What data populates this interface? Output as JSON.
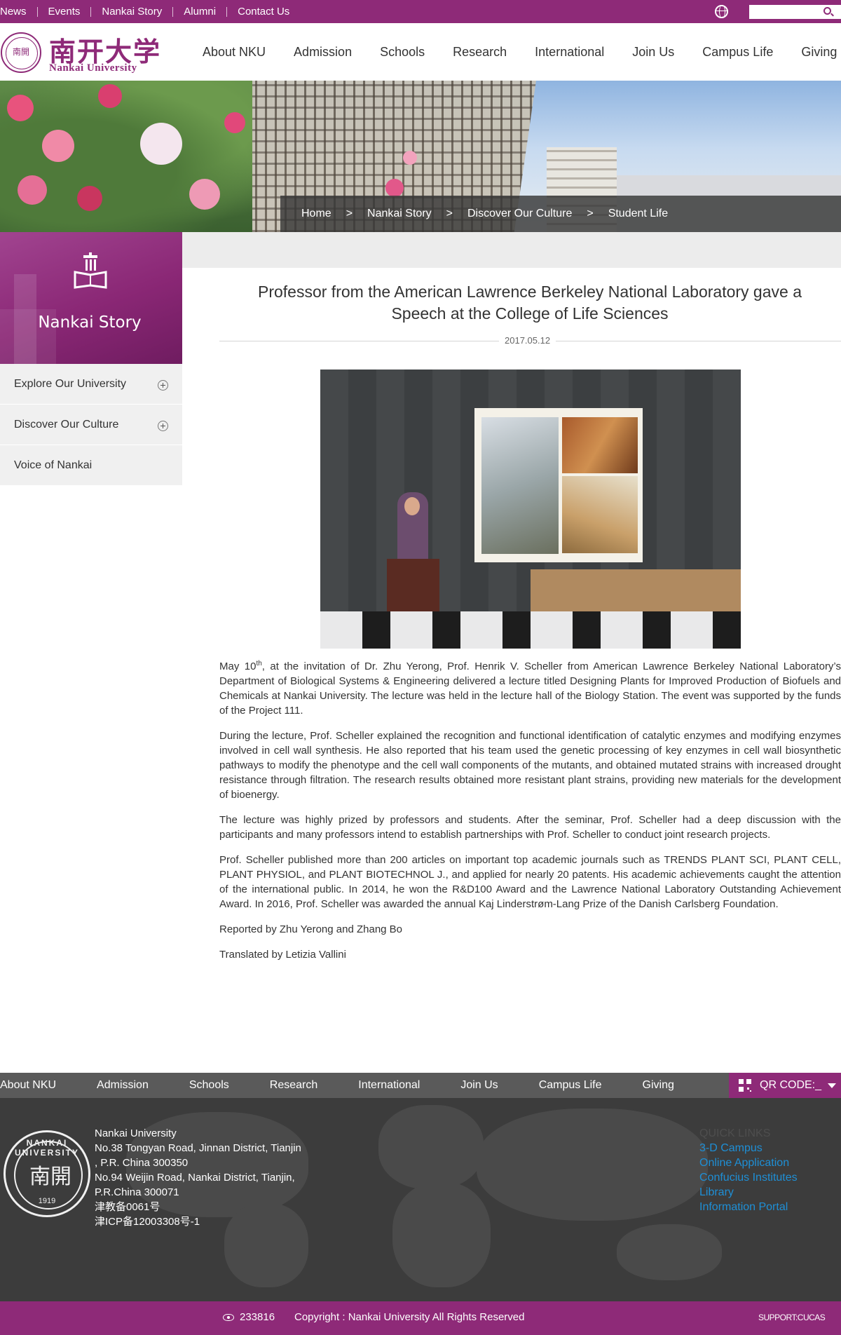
{
  "topbar": {
    "links": [
      "News",
      "Events",
      "Nankai Story",
      "Alumni",
      "Contact Us"
    ],
    "search_placeholder": ""
  },
  "header": {
    "logo_cn": "南开大学",
    "logo_en": "Nankai University",
    "nav": [
      "About NKU",
      "Admission",
      "Schools",
      "Research",
      "International",
      "Join Us",
      "Campus Life",
      "Giving"
    ]
  },
  "breadcrumb": [
    "Home",
    "Nankai Story",
    "Discover Our Culture",
    "Student Life"
  ],
  "breadcrumb_separator": ">",
  "sidebar": {
    "title": "Nankai Story",
    "items": [
      {
        "label": "Explore Our University",
        "expandable": true
      },
      {
        "label": "Discover Our Culture",
        "expandable": true
      },
      {
        "label": "Voice of Nankai",
        "expandable": false
      }
    ]
  },
  "article": {
    "title": "Professor from the American Lawrence Berkeley National Laboratory gave a Speech at the College of Life Sciences",
    "date": "2017.05.12",
    "p1_prefix": "May 10",
    "p1_sup": "th",
    "p1_rest": ", at the invitation of Dr. Zhu Yerong, Prof. Henrik V. Scheller from American Lawrence Berkeley National Laboratory’s Department of Biological Systems & Engineering delivered a lecture titled Designing Plants for Improved Production of Biofuels and Chemicals at Nankai University. The lecture was held in the lecture hall of the Biology Station. The event was supported by the funds of the Project 111.",
    "p2": "During the lecture, Prof. Scheller explained the recognition and functional identification of catalytic enzymes and modifying enzymes involved in cell wall synthesis. He also reported that his team used the genetic processing of key enzymes in cell wall biosynthetic pathways to modify the phenotype and the cell wall components of the mutants, and obtained mutated strains with increased drought resistance through filtration. The research results obtained more resistant plant strains, providing new materials for the development of bioenergy.",
    "p3": "The lecture was highly prized by professors and students. After the seminar, Prof. Scheller had a deep discussion with the participants and many professors intend to establish partnerships with Prof. Scheller to conduct joint research projects.",
    "p4": "Prof. Scheller published more than 200 articles on important top academic journals such as TRENDS PLANT SCI, PLANT CELL, PLANT PHYSIOL, and PLANT BIOTECHNOL J., and applied for nearly 20 patents. His academic achievements caught the attention of the international public. In 2014, he won the R&D100 Award and the Lawrence National Laboratory Outstanding Achievement Award. In 2016, Prof. Scheller was awarded the annual Kaj Linderstrøm-Lang Prize of the Danish Carlsberg Foundation.",
    "p5": "Reported by Zhu Yerong and Zhang Bo",
    "p6": "Translated by Letizia Vallini"
  },
  "footer": {
    "nav": [
      "About NKU",
      "Admission",
      "Schools",
      "Research",
      "International",
      "Join Us",
      "Campus Life",
      "Giving"
    ],
    "qr_label": "QR CODE:_",
    "seal_text": "NANKAI UNIVERSITY",
    "seal_center": "南開",
    "seal_year": "1919",
    "address_lines": [
      "Nankai University",
      "No.38 Tongyan Road, Jinnan District, Tianjin",
      ", P.R. China 300350",
      "No.94 Weijin Road,  Nankai District, Tianjin,",
      "P.R.China  300071",
      "津教备0061号",
      "津ICP备12003308号-1"
    ],
    "quick_links_title": "QUICK LINKS",
    "quick_links": [
      "3-D Campus",
      "Online Application",
      "Confucius Institutes",
      "Library",
      "Information Portal"
    ],
    "visits": "233816",
    "copyright": "Copyright : Nankai University All Rights Reserved",
    "support": "SUPPORT:CUCAS"
  },
  "colors": {
    "brand": "#8e2a78",
    "footer_nav": "#5a5a5a",
    "footer_main": "#3c3c3c",
    "link_blue": "#1e8fd6"
  }
}
